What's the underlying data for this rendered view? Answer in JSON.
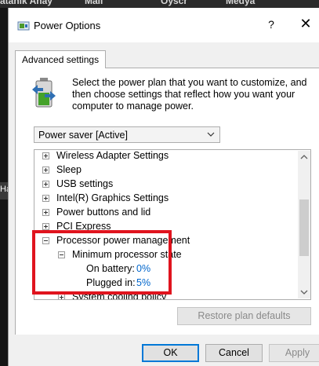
{
  "background": {
    "menu_items": [
      "atanık Anay",
      "Mail",
      "Oyscr",
      "Medya"
    ],
    "left_snippet": "Ha"
  },
  "dialog": {
    "title": "Power Options",
    "help_label": "?",
    "close_label": "✕",
    "tab_label": "Advanced settings",
    "intro_text": "Select the power plan that you want to customize, and then choose settings that reflect how you want your computer to manage power.",
    "plan_select_value": "Power saver [Active]",
    "tree": [
      {
        "label": "Wireless Adapter Settings",
        "expander": "+",
        "value": ""
      },
      {
        "label": "Sleep",
        "expander": "+",
        "value": ""
      },
      {
        "label": "USB settings",
        "expander": "+",
        "value": ""
      },
      {
        "label": "Intel(R) Graphics Settings",
        "expander": "+",
        "value": ""
      },
      {
        "label": "Power buttons and lid",
        "expander": "+",
        "value": ""
      },
      {
        "label": "PCI Express",
        "expander": "+",
        "value": ""
      },
      {
        "label": "Processor power management",
        "expander": "-",
        "value": ""
      },
      {
        "label": "Minimum processor state",
        "expander": "-",
        "value": ""
      },
      {
        "label": "On battery:",
        "expander": "",
        "value": "0%"
      },
      {
        "label": "Plugged in:",
        "expander": "",
        "value": "5%"
      },
      {
        "label": "System cooling policy",
        "expander": "+",
        "value": ""
      }
    ],
    "restore_button": "Restore plan defaults",
    "ok_button": "OK",
    "cancel_button": "Cancel",
    "apply_button": "Apply"
  },
  "colors": {
    "highlight_border": "#e0141e",
    "value_link": "#0066cc",
    "ok_focus": "#0078d7"
  }
}
